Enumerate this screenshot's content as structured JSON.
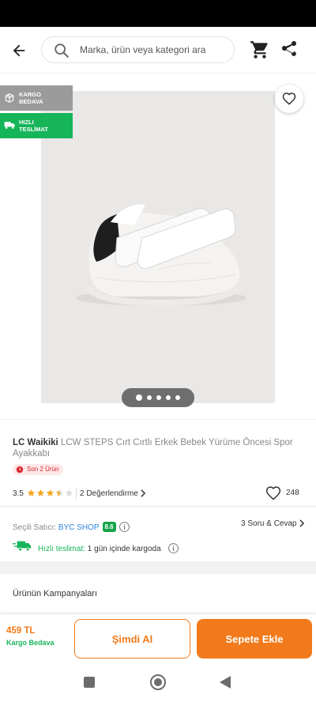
{
  "header": {
    "search_placeholder": "Marka, ürün veya kategori ara",
    "icons": [
      "back-arrow-icon",
      "search-icon",
      "cart-icon",
      "share-icon"
    ]
  },
  "gallery": {
    "badges": [
      {
        "label_line1": "KARGO",
        "label_line2": "BEDAVA",
        "icon": "package-icon",
        "color": "#9b9b9b"
      },
      {
        "label_line1": "HIZLI",
        "label_line2": "TESLİMAT",
        "icon": "truck-icon",
        "color": "#17b55a"
      }
    ],
    "image_count": 5,
    "active_image": 1
  },
  "product": {
    "brand": "LC Waikiki",
    "name": "LCW STEPS Cırt Cırtlı Erkek Bebek Yürüme Öncesi Spor Ayakkabı",
    "stock_tag": "Son 2 Ürün",
    "rating": "3.5",
    "rating_stars": 3.5,
    "reviews_label": "2 Değerlendirme",
    "favorite_count": "248"
  },
  "seller": {
    "label": "Seçili Satıcı: ",
    "name": "BYC SHOP",
    "score": "8.6",
    "qa_label": "3 Soru & Cevap",
    "fast_label": "Hızlı teslimat:",
    "fast_text": " 1 gün içinde kargoda"
  },
  "campaign": {
    "title": "Ürünün Kampanyaları"
  },
  "purchase": {
    "price": "459 TL",
    "shipping": "Kargo Bedava",
    "buy_now_label": "Şimdi Al",
    "add_to_cart_label": "Sepete Ekle"
  },
  "colors": {
    "accent": "#f27a1a",
    "green": "#17b55a",
    "link": "#2e86de",
    "stock_red": "#d9262c"
  }
}
